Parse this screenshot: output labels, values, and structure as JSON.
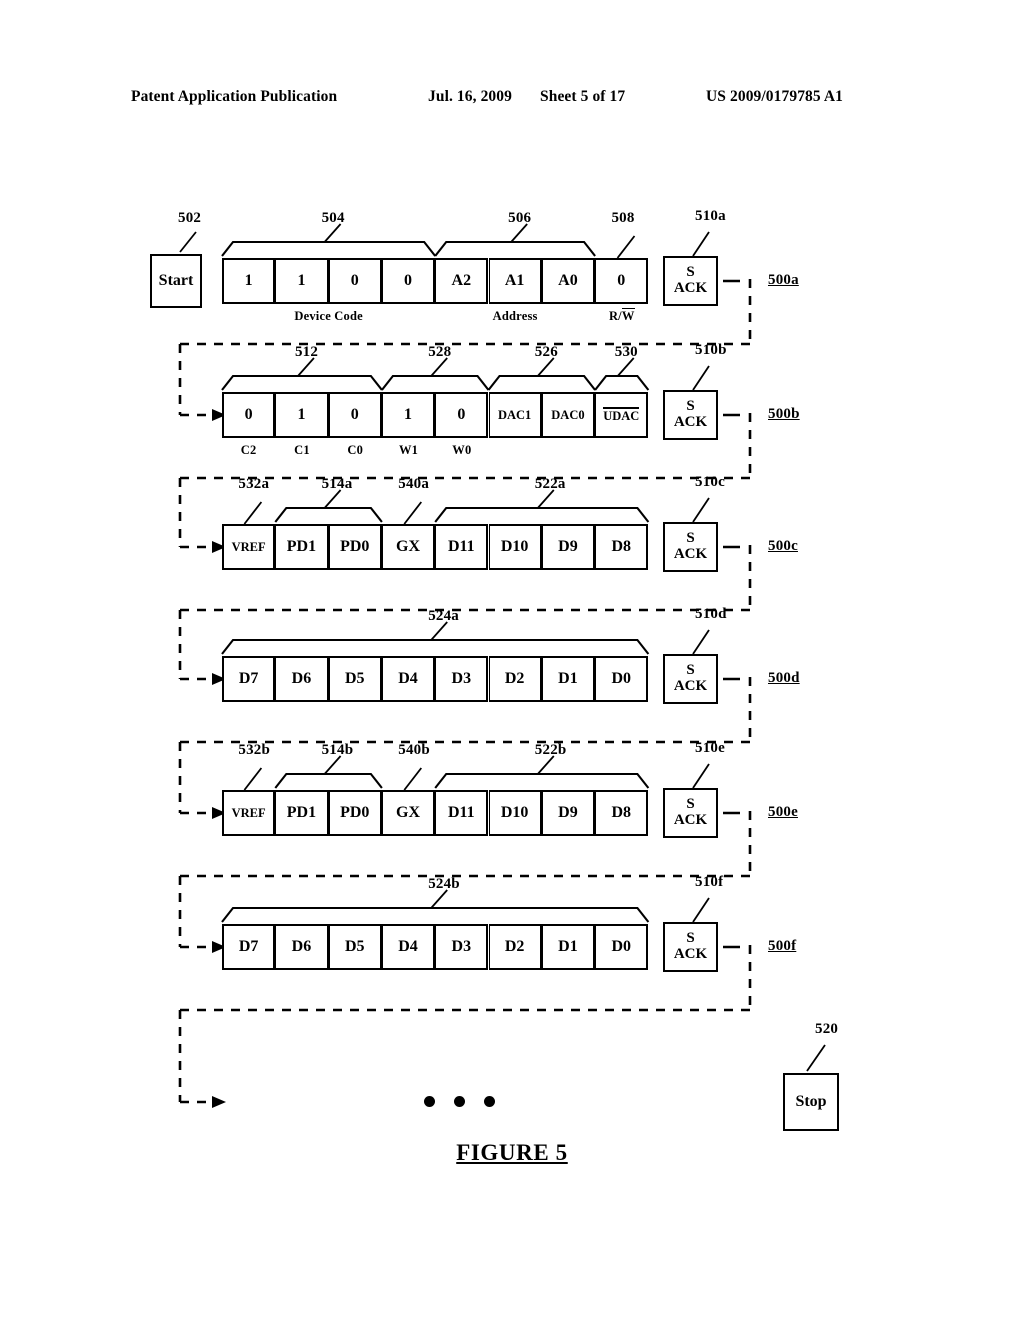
{
  "header": {
    "publication": "Patent Application Publication",
    "date": "Jul. 16, 2009",
    "sheet": "Sheet 5 of 17",
    "patent_number": "US 2009/0179785 A1"
  },
  "figure": {
    "caption": "FIGURE 5",
    "start_label": "Start",
    "stop_label": "Stop",
    "start_ref": "502",
    "stop_ref": "520",
    "ack_line1": "S",
    "ack_line2": "ACK",
    "ellipsis": "• • •"
  },
  "rows": [
    {
      "id": "500a",
      "ack_ref": "510a",
      "cells": [
        {
          "text": "1"
        },
        {
          "text": "1"
        },
        {
          "text": "0"
        },
        {
          "text": "0"
        },
        {
          "text": "A2"
        },
        {
          "text": "A1"
        },
        {
          "text": "A0"
        },
        {
          "text": "0"
        }
      ],
      "braces": [
        {
          "ref": "504",
          "from": 0,
          "to": 3
        },
        {
          "ref": "506",
          "from": 4,
          "to": 6
        },
        {
          "ref": "508",
          "from": 7,
          "to": 7,
          "leader_only": true
        }
      ],
      "sublabels": [
        {
          "text": "Device Code",
          "from": 0,
          "to": 3
        },
        {
          "text": "Address",
          "from": 4,
          "to": 6
        },
        {
          "text": "R/W",
          "from": 7,
          "to": 7,
          "overbar_tail": "W"
        }
      ]
    },
    {
      "id": "500b",
      "ack_ref": "510b",
      "cells": [
        {
          "text": "0"
        },
        {
          "text": "1"
        },
        {
          "text": "0"
        },
        {
          "text": "1"
        },
        {
          "text": "0"
        },
        {
          "text": "DAC1",
          "small": true
        },
        {
          "text": "DAC0",
          "small": true
        },
        {
          "text": "UDAC",
          "small": true,
          "overbar": true
        }
      ],
      "braces": [
        {
          "ref": "512",
          "from": 0,
          "to": 2
        },
        {
          "ref": "528",
          "from": 3,
          "to": 4
        },
        {
          "ref": "526",
          "from": 5,
          "to": 6
        },
        {
          "ref": "530",
          "from": 7,
          "to": 7
        }
      ],
      "sublabels": [
        {
          "text": "C2",
          "from": 0,
          "to": 0
        },
        {
          "text": "C1",
          "from": 1,
          "to": 1
        },
        {
          "text": "C0",
          "from": 2,
          "to": 2
        },
        {
          "text": "W1",
          "from": 3,
          "to": 3
        },
        {
          "text": "W0",
          "from": 4,
          "to": 4
        }
      ]
    },
    {
      "id": "500c",
      "ack_ref": "510c",
      "cells": [
        {
          "text": "VREF",
          "small": true
        },
        {
          "text": "PD1"
        },
        {
          "text": "PD0"
        },
        {
          "text": "GX"
        },
        {
          "text": "D11"
        },
        {
          "text": "D10"
        },
        {
          "text": "D9"
        },
        {
          "text": "D8"
        }
      ],
      "braces": [
        {
          "ref": "532a",
          "from": 0,
          "to": 0,
          "leader_only": true
        },
        {
          "ref": "514a",
          "from": 1,
          "to": 2
        },
        {
          "ref": "540a",
          "from": 3,
          "to": 3,
          "leader_only": true
        },
        {
          "ref": "522a",
          "from": 4,
          "to": 7
        }
      ],
      "sublabels": []
    },
    {
      "id": "500d",
      "ack_ref": "510d",
      "cells": [
        {
          "text": "D7"
        },
        {
          "text": "D6"
        },
        {
          "text": "D5"
        },
        {
          "text": "D4"
        },
        {
          "text": "D3"
        },
        {
          "text": "D2"
        },
        {
          "text": "D1"
        },
        {
          "text": "D0"
        }
      ],
      "braces": [
        {
          "ref": "524a",
          "from": 0,
          "to": 7
        }
      ],
      "sublabels": []
    },
    {
      "id": "500e",
      "ack_ref": "510e",
      "cells": [
        {
          "text": "VREF",
          "small": true
        },
        {
          "text": "PD1"
        },
        {
          "text": "PD0"
        },
        {
          "text": "GX"
        },
        {
          "text": "D11"
        },
        {
          "text": "D10"
        },
        {
          "text": "D9"
        },
        {
          "text": "D8"
        }
      ],
      "braces": [
        {
          "ref": "532b",
          "from": 0,
          "to": 0,
          "leader_only": true
        },
        {
          "ref": "514b",
          "from": 1,
          "to": 2
        },
        {
          "ref": "540b",
          "from": 3,
          "to": 3,
          "leader_only": true
        },
        {
          "ref": "522b",
          "from": 4,
          "to": 7
        }
      ],
      "sublabels": []
    },
    {
      "id": "500f",
      "ack_ref": "510f",
      "cells": [
        {
          "text": "D7"
        },
        {
          "text": "D6"
        },
        {
          "text": "D5"
        },
        {
          "text": "D4"
        },
        {
          "text": "D3"
        },
        {
          "text": "D2"
        },
        {
          "text": "D1"
        },
        {
          "text": "D0"
        }
      ],
      "braces": [
        {
          "ref": "524b",
          "from": 0,
          "to": 7
        }
      ],
      "sublabels": []
    }
  ]
}
